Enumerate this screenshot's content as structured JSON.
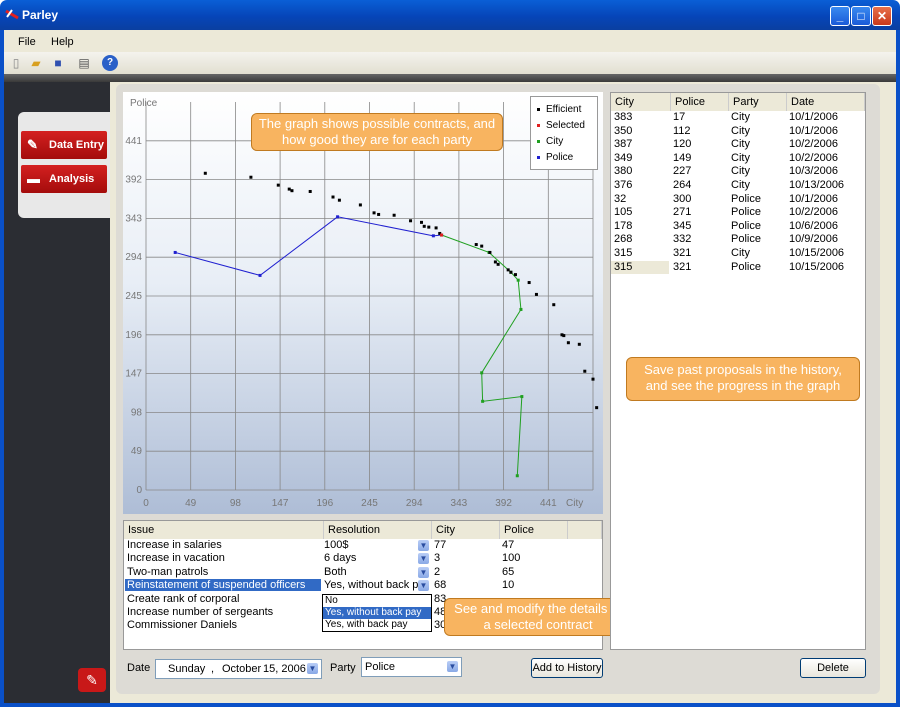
{
  "window": {
    "title": "Parley"
  },
  "menu": [
    "File",
    "Help"
  ],
  "toolbar": [
    "new-icon",
    "open-icon",
    "save-icon",
    "print-icon",
    "help-icon"
  ],
  "nav": {
    "data_entry": "Data Entry",
    "analysis": "Analysis"
  },
  "chart": {
    "y_axis_label": "Police",
    "x_axis_label": "City",
    "y_ticks": [
      "0",
      "49",
      "98",
      "147",
      "196",
      "245",
      "294",
      "343",
      "392",
      "441"
    ],
    "x_ticks": [
      "0",
      "49",
      "98",
      "147",
      "196",
      "245",
      "294",
      "343",
      "392",
      "441"
    ],
    "legend": [
      "Efficient",
      "Selected",
      "City",
      "Police"
    ],
    "colors": {
      "efficient": "#000000",
      "selected": "#e02020",
      "city": "#20a020",
      "police": "#2020d0"
    }
  },
  "chart_data": {
    "type": "scatter",
    "xlabel": "City",
    "ylabel": "Police",
    "xlim": [
      0,
      490
    ],
    "ylim": [
      0,
      490
    ],
    "grid": true,
    "legend_position": "top-right",
    "series": [
      {
        "name": "Efficient",
        "points": [
          [
            65,
            400
          ],
          [
            115,
            395
          ],
          [
            145,
            385
          ],
          [
            157,
            380
          ],
          [
            160,
            378
          ],
          [
            180,
            377
          ],
          [
            205,
            370
          ],
          [
            212,
            366
          ],
          [
            235,
            360
          ],
          [
            250,
            350
          ],
          [
            255,
            348
          ],
          [
            272,
            347
          ],
          [
            290,
            340
          ],
          [
            302,
            338
          ],
          [
            305,
            333
          ],
          [
            310,
            332
          ],
          [
            318,
            331
          ],
          [
            322,
            324
          ],
          [
            362,
            310
          ],
          [
            368,
            308
          ],
          [
            377,
            300
          ],
          [
            383,
            288
          ],
          [
            386,
            285
          ],
          [
            397,
            278
          ],
          [
            400,
            275
          ],
          [
            405,
            272
          ],
          [
            420,
            262
          ],
          [
            428,
            247
          ],
          [
            447,
            234
          ],
          [
            456,
            196
          ],
          [
            458,
            195
          ],
          [
            463,
            186
          ],
          [
            475,
            184
          ],
          [
            481,
            150
          ],
          [
            490,
            140
          ],
          [
            494,
            104
          ]
        ]
      },
      {
        "name": "Selected",
        "points": [
          [
            324,
            322
          ]
        ]
      },
      {
        "name": "City",
        "points": [
          [
            324,
            322
          ],
          [
            376,
            300
          ],
          [
            400,
            275
          ],
          [
            408,
            265
          ],
          [
            411,
            228
          ],
          [
            368,
            148
          ],
          [
            369,
            112
          ],
          [
            412,
            118
          ],
          [
            407,
            18
          ]
        ]
      },
      {
        "name": "Police",
        "points": [
          [
            32,
            300
          ],
          [
            125,
            271
          ],
          [
            210,
            345
          ],
          [
            315,
            321
          ],
          [
            324,
            322
          ]
        ]
      }
    ]
  },
  "callouts": {
    "graph": "The graph shows possible contracts, and how good they are for each party",
    "history": "Save past proposals in the history, and see the progress in the graph",
    "details": "See and modify the details of a selected contract"
  },
  "issues": {
    "columns": [
      "Issue",
      "Resolution",
      "City",
      "Police"
    ],
    "rows": [
      {
        "issue": "Increase in salaries",
        "resolution": "100$",
        "city": "77",
        "police": "47"
      },
      {
        "issue": "Increase in vacation",
        "resolution": "6 days",
        "city": "3",
        "police": "100"
      },
      {
        "issue": "Two-man patrols",
        "resolution": "Both",
        "city": "2",
        "police": "65"
      },
      {
        "issue": "Reinstatement of suspended officers",
        "resolution": "Yes, without back pa",
        "city": "68",
        "police": "10"
      },
      {
        "issue": "Create rank of corporal",
        "resolution": "",
        "city": "83",
        "police": ""
      },
      {
        "issue": "Increase number of sergeants",
        "resolution": "",
        "city": "48",
        "police": ""
      },
      {
        "issue": "Commissioner Daniels",
        "resolution": "",
        "city": "30",
        "police": ""
      }
    ],
    "dropdown_options": [
      "No",
      "Yes, without back pay",
      "Yes, with back pay"
    ]
  },
  "history": {
    "columns": [
      "City",
      "Police",
      "Party",
      "Date"
    ],
    "rows": [
      {
        "city": "383",
        "police": "17",
        "party": "City",
        "date": "10/1/2006"
      },
      {
        "city": "350",
        "police": "112",
        "party": "City",
        "date": "10/1/2006"
      },
      {
        "city": "387",
        "police": "120",
        "party": "City",
        "date": "10/2/2006"
      },
      {
        "city": "349",
        "police": "149",
        "party": "City",
        "date": "10/2/2006"
      },
      {
        "city": "380",
        "police": "227",
        "party": "City",
        "date": "10/3/2006"
      },
      {
        "city": "376",
        "police": "264",
        "party": "City",
        "date": "10/13/2006"
      },
      {
        "city": "32",
        "police": "300",
        "party": "Police",
        "date": "10/1/2006"
      },
      {
        "city": "105",
        "police": "271",
        "party": "Police",
        "date": "10/2/2006"
      },
      {
        "city": "178",
        "police": "345",
        "party": "Police",
        "date": "10/6/2006"
      },
      {
        "city": "268",
        "police": "332",
        "party": "Police",
        "date": "10/9/2006"
      },
      {
        "city": "315",
        "police": "321",
        "party": "City",
        "date": "10/15/2006"
      },
      {
        "city": "315",
        "police": "321",
        "party": "Police",
        "date": "10/15/2006"
      }
    ]
  },
  "bottom": {
    "date_label": "Date",
    "date_day": "Sunday",
    "date_sep": ",",
    "date_month": "October",
    "date_daynum": "15, 2006",
    "party_label": "Party",
    "party_value": "Police",
    "add_history": "Add to History",
    "delete": "Delete"
  }
}
